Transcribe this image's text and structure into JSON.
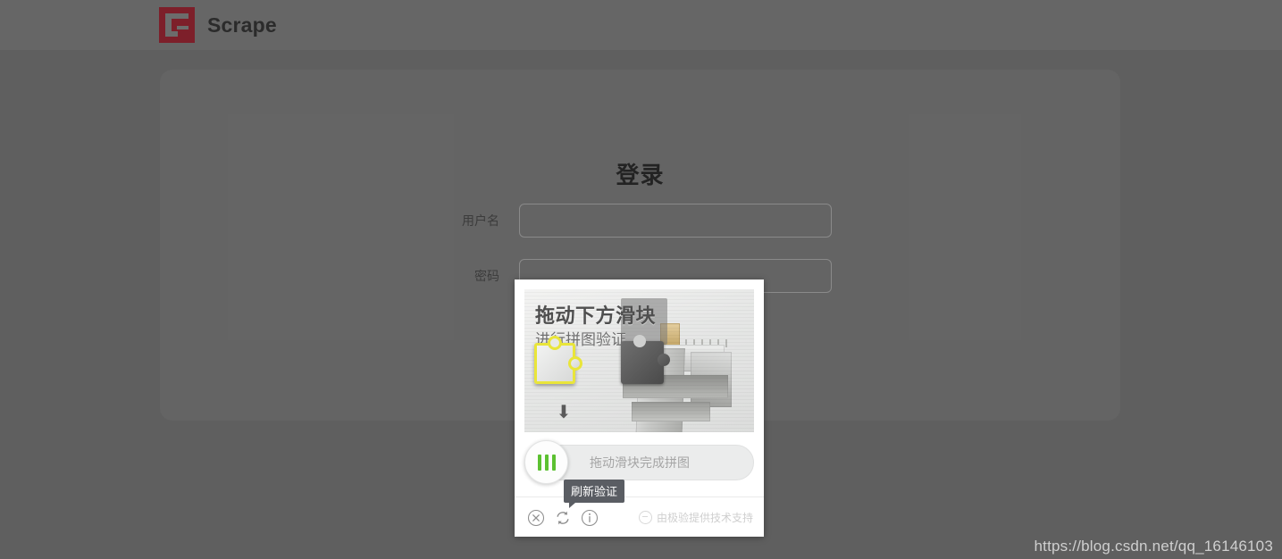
{
  "navbar": {
    "logo_icon": "scrape-g-logo-icon",
    "brand": "Scrape"
  },
  "login": {
    "title": "登录",
    "fields": [
      {
        "label": "用户名",
        "value": "",
        "placeholder": "",
        "name": "username"
      },
      {
        "label": "密码",
        "value": "",
        "placeholder": "",
        "name": "password"
      }
    ]
  },
  "captcha": {
    "provider": "geetest",
    "hint_main": "拖动下方滑块",
    "hint_sub": "进行拼图验证",
    "slider_text": "拖动滑块完成拼图",
    "handle_icon": "three-bars-icon",
    "handle_accent": "#5cc131",
    "piece_outline": "#e9e53a",
    "tooltip": "刷新验证",
    "footer_icons": [
      {
        "name": "close-icon",
        "label": "关闭"
      },
      {
        "name": "refresh-icon",
        "label": "刷新验证"
      },
      {
        "name": "info-icon",
        "label": "帮助"
      }
    ],
    "brand_text": "由极验提供技术支持",
    "down_arrow_icon": "chevron-double-down-icon"
  },
  "watermark": "https://blog.csdn.net/qq_16146103"
}
